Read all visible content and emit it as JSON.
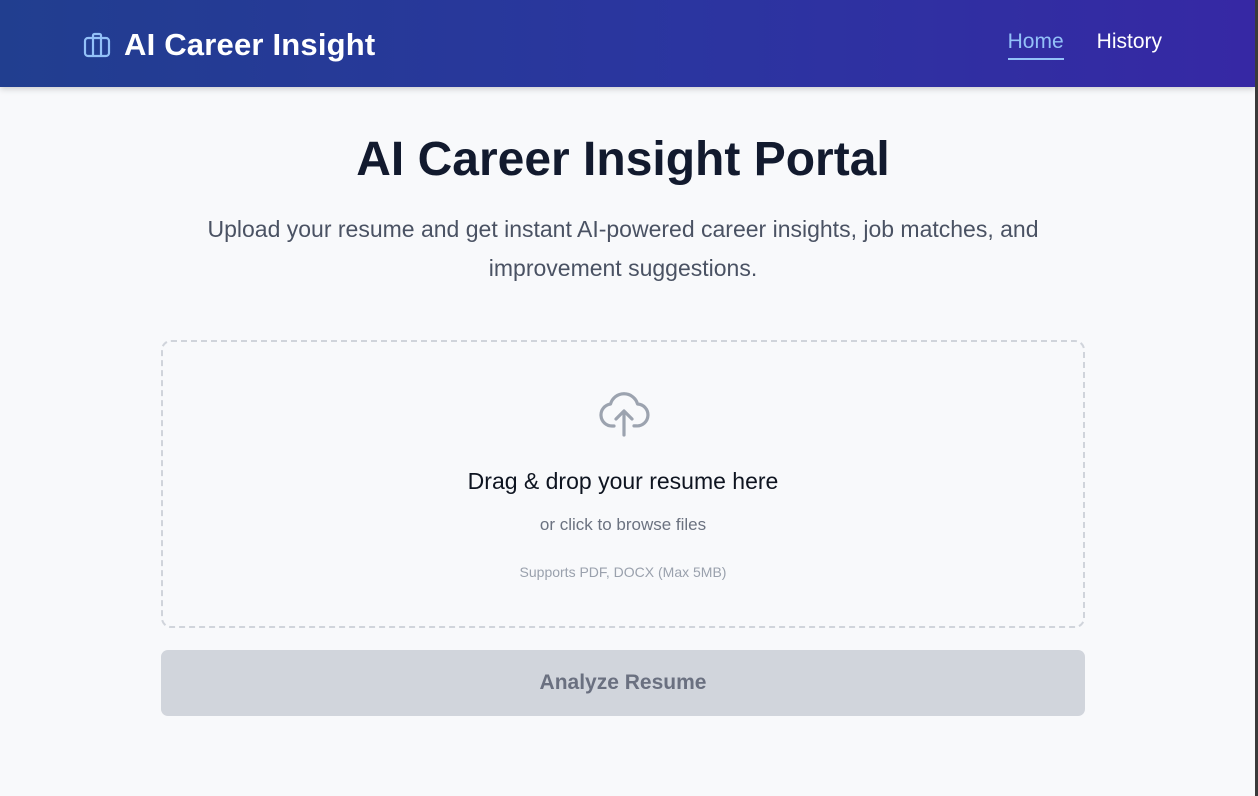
{
  "header": {
    "brand_icon": "briefcase-icon",
    "title": "AI Career Insight",
    "nav": [
      {
        "label": "Home",
        "active": true
      },
      {
        "label": "History",
        "active": false
      }
    ]
  },
  "hero": {
    "title": "AI Career Insight Portal",
    "subtitle": "Upload your resume and get instant AI-powered career insights, job matches, and improvement suggestions."
  },
  "upload": {
    "icon": "cloud-upload-icon",
    "title": "Drag & drop your resume here",
    "subtitle": "or click to browse files",
    "hint": "Supports PDF, DOCX (Max 5MB)"
  },
  "actions": {
    "analyze_label": "Analyze Resume",
    "analyze_disabled": true
  },
  "colors": {
    "nav_gradient_start": "#213e8f",
    "nav_gradient_end": "#3628a4",
    "active_link": "#93c1f8",
    "background": "#f8f9fb",
    "disabled_button": "#d1d5dc"
  }
}
